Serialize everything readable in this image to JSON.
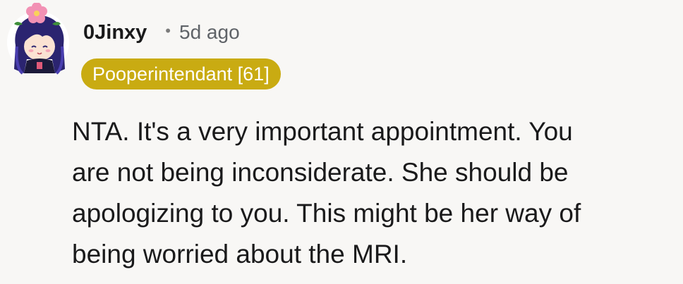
{
  "comment": {
    "author": "0Jinxy",
    "separator": "•",
    "timestamp": "5d ago",
    "flair": "Pooperintendant [61]",
    "body_lines": [
      "NTA. It's a very important appointment. You",
      "are not being inconsiderate. She should be",
      "apologizing to you. This might be her way of",
      "being worried about the MRI."
    ]
  },
  "colors": {
    "background": "#f8f7f5",
    "flair_bg": "#c9ab12",
    "text": "#1a1a1b",
    "meta": "#5f6368"
  },
  "icons": {
    "avatar": "anime-girl-avatar-with-pink-flower"
  }
}
